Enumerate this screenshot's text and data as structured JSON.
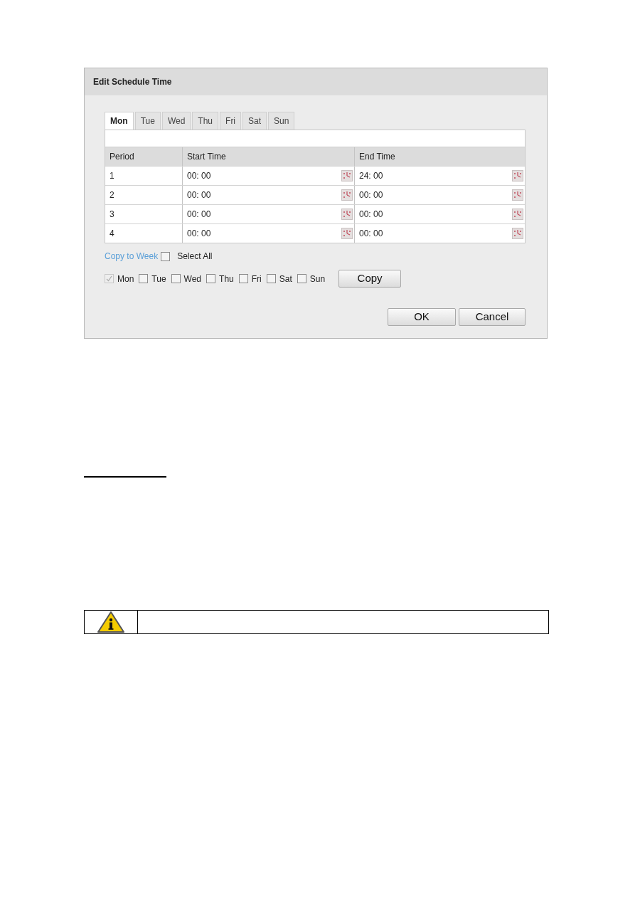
{
  "dialog": {
    "title": "Edit Schedule Time",
    "tabs": [
      {
        "label": "Mon",
        "selected": true
      },
      {
        "label": "Tue",
        "selected": false
      },
      {
        "label": "Wed",
        "selected": false
      },
      {
        "label": "Thu",
        "selected": false
      },
      {
        "label": "Fri",
        "selected": false
      },
      {
        "label": "Sat",
        "selected": false
      },
      {
        "label": "Sun",
        "selected": false
      }
    ],
    "table": {
      "columns": [
        "Period",
        "Start Time",
        "End Time"
      ],
      "rows": [
        {
          "period": "1",
          "start": "00: 00",
          "end": "24: 00"
        },
        {
          "period": "2",
          "start": "00: 00",
          "end": "00: 00"
        },
        {
          "period": "3",
          "start": "00: 00",
          "end": "00: 00"
        },
        {
          "period": "4",
          "start": "00: 00",
          "end": "00: 00"
        }
      ]
    },
    "copy_to_week": {
      "label": "Copy to Week",
      "select_all": {
        "label": "Select All",
        "checked": false
      }
    },
    "days": [
      {
        "label": "Mon",
        "checked": true,
        "disabled": true
      },
      {
        "label": "Tue",
        "checked": false,
        "disabled": false
      },
      {
        "label": "Wed",
        "checked": false,
        "disabled": false
      },
      {
        "label": "Thu",
        "checked": false,
        "disabled": false
      },
      {
        "label": "Fri",
        "checked": false,
        "disabled": false
      },
      {
        "label": "Sat",
        "checked": false,
        "disabled": false
      },
      {
        "label": "Sun",
        "checked": false,
        "disabled": false
      }
    ],
    "copy_button": "Copy",
    "buttons": [
      "OK",
      "Cancel"
    ]
  }
}
